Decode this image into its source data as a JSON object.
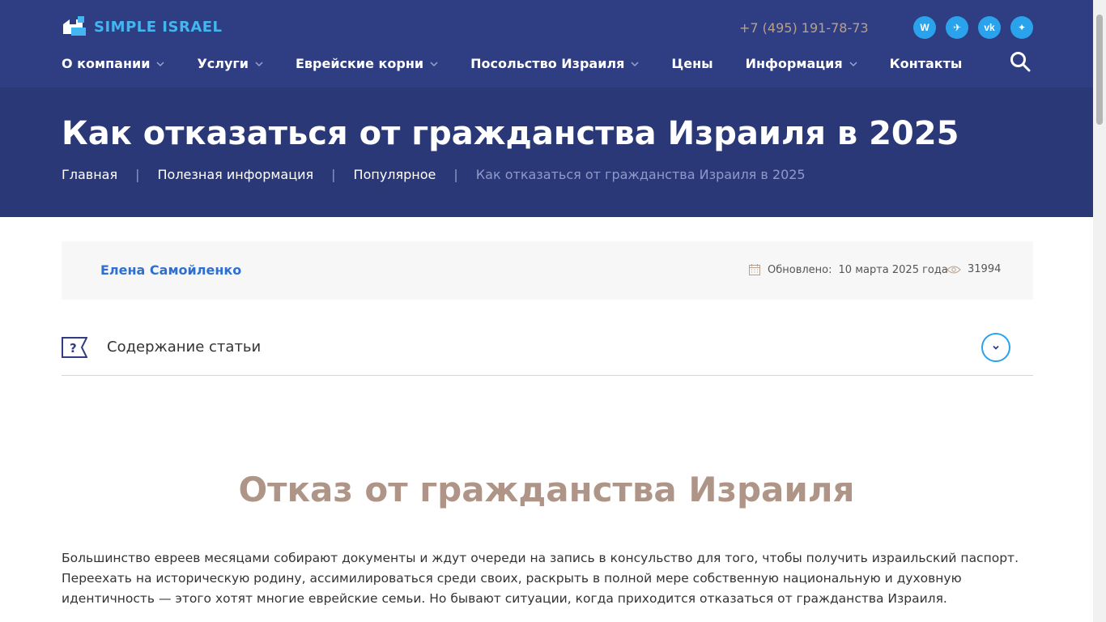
{
  "header": {
    "logo_text": "SIMPLE ISRAEL",
    "phone": "+7 (495) 191-78-73",
    "socials": [
      {
        "label": "W",
        "icon": "whatsapp-icon"
      },
      {
        "label": "✈",
        "icon": "telegram-icon"
      },
      {
        "label": "vk",
        "icon": "vk-icon"
      },
      {
        "label": "✦",
        "icon": "star-icon"
      }
    ],
    "nav": [
      {
        "label": "О компании",
        "has_dropdown": true
      },
      {
        "label": "Услуги",
        "has_dropdown": true
      },
      {
        "label": "Еврейские корни",
        "has_dropdown": true
      },
      {
        "label": "Посольство Израиля",
        "has_dropdown": true
      },
      {
        "label": "Цены",
        "has_dropdown": false
      },
      {
        "label": "Информация",
        "has_dropdown": true
      },
      {
        "label": "Контакты",
        "has_dropdown": false
      }
    ]
  },
  "banner": {
    "title": "Как отказаться от гражданства Израиля в 2025",
    "breadcrumb": [
      "Главная",
      "Полезная информация",
      "Популярное",
      "Как отказаться от гражданства Израиля в 2025"
    ]
  },
  "meta": {
    "author": "Елена Самойленко",
    "updated_label": "Обновлено:",
    "updated_date": "10 марта 2025 года",
    "views": "31994"
  },
  "toc": {
    "label": "Содержание статьи"
  },
  "article": {
    "title": "Отказ от гражданства Израиля",
    "paragraph": "Большинство евреев месяцами собирают документы и ждут очереди на запись в консульство для того, чтобы получить израильский паспорт. Переехать на историческую родину, ассимилироваться среди своих, раскрыть в полной мере собственную национальную и духовную идентичность — этого хотят многие еврейские семьи. Но бывают ситуации, когда приходится отказаться от гражданства Израиля."
  },
  "colors": {
    "header_bg": "#2f3e82",
    "banner_bg": "#2a3878",
    "accent": "#2aa3ec",
    "article_title": "#ae9587"
  }
}
